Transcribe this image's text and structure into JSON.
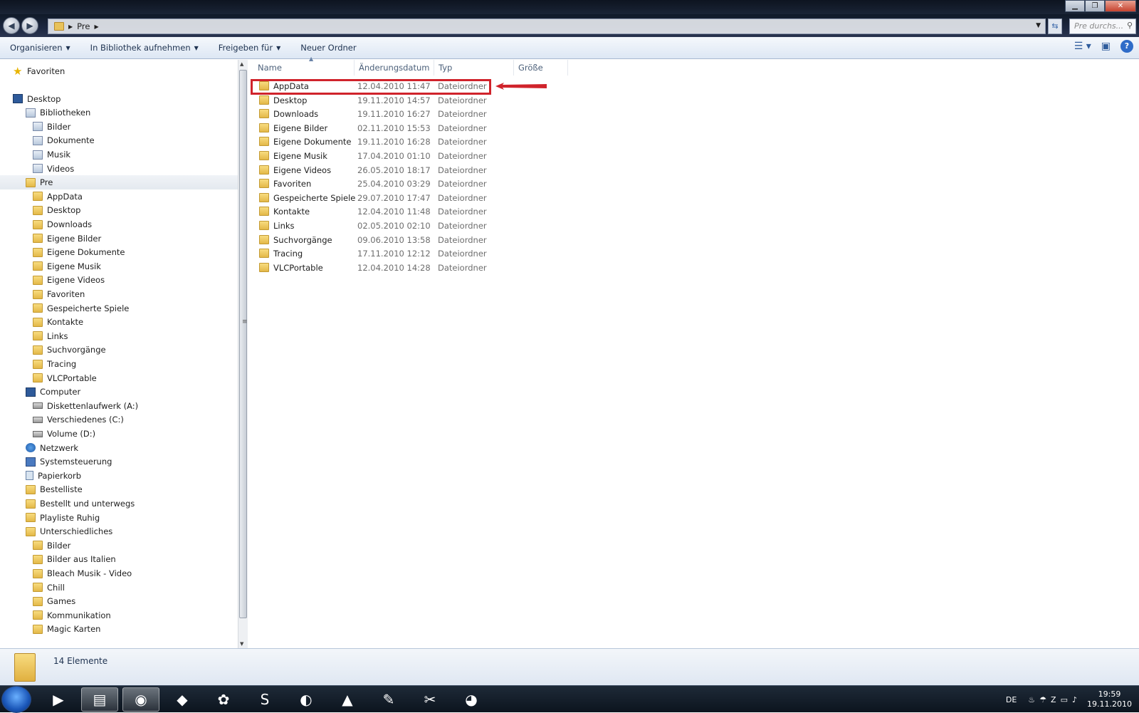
{
  "window": {
    "controls": {
      "minimize": "▁",
      "maximize": "❐",
      "close": "✕"
    }
  },
  "address": {
    "crumbs": [
      "Pre"
    ],
    "search_placeholder": "Pre durchs..."
  },
  "toolbar": {
    "organize": "Organisieren",
    "library": "In Bibliothek aufnehmen",
    "share": "Freigeben für",
    "new_folder": "Neuer Ordner"
  },
  "nav": [
    {
      "label": "Favoriten",
      "icon": "star-icon",
      "indent": 0
    },
    {
      "label": "Desktop",
      "icon": "monitor-icon",
      "indent": 0
    },
    {
      "label": "Bibliotheken",
      "icon": "library-icon",
      "indent": 1
    },
    {
      "label": "Bilder",
      "icon": "pictures-library-icon",
      "indent": 2
    },
    {
      "label": "Dokumente",
      "icon": "documents-library-icon",
      "indent": 2
    },
    {
      "label": "Musik",
      "icon": "music-library-icon",
      "indent": 2
    },
    {
      "label": "Videos",
      "icon": "videos-library-icon",
      "indent": 2
    },
    {
      "label": "Pre",
      "icon": "user-folder-icon",
      "indent": 1,
      "selected": true
    },
    {
      "label": "AppData",
      "icon": "folder-icon",
      "indent": 2
    },
    {
      "label": "Desktop",
      "icon": "folder-icon",
      "indent": 2
    },
    {
      "label": "Downloads",
      "icon": "folder-icon",
      "indent": 2
    },
    {
      "label": "Eigene Bilder",
      "icon": "folder-icon",
      "indent": 2
    },
    {
      "label": "Eigene Dokumente",
      "icon": "folder-icon",
      "indent": 2
    },
    {
      "label": "Eigene Musik",
      "icon": "folder-icon",
      "indent": 2
    },
    {
      "label": "Eigene Videos",
      "icon": "folder-icon",
      "indent": 2
    },
    {
      "label": "Favoriten",
      "icon": "folder-icon",
      "indent": 2
    },
    {
      "label": "Gespeicherte Spiele",
      "icon": "folder-icon",
      "indent": 2
    },
    {
      "label": "Kontakte",
      "icon": "folder-icon",
      "indent": 2
    },
    {
      "label": "Links",
      "icon": "folder-icon",
      "indent": 2
    },
    {
      "label": "Suchvorgänge",
      "icon": "folder-icon",
      "indent": 2
    },
    {
      "label": "Tracing",
      "icon": "folder-icon",
      "indent": 2
    },
    {
      "label": "VLCPortable",
      "icon": "folder-icon",
      "indent": 2
    },
    {
      "label": "Computer",
      "icon": "computer-icon",
      "indent": 1
    },
    {
      "label": "Diskettenlaufwerk (A:)",
      "icon": "floppy-drive-icon",
      "indent": 2
    },
    {
      "label": "Verschiedenes (C:)",
      "icon": "hard-drive-icon",
      "indent": 2
    },
    {
      "label": "Volume (D:)",
      "icon": "hard-drive-icon",
      "indent": 2
    },
    {
      "label": "Netzwerk",
      "icon": "network-icon",
      "indent": 1
    },
    {
      "label": "Systemsteuerung",
      "icon": "control-panel-icon",
      "indent": 1
    },
    {
      "label": "Papierkorb",
      "icon": "recycle-bin-icon",
      "indent": 1
    },
    {
      "label": "Bestelliste",
      "icon": "folder-icon",
      "indent": 1
    },
    {
      "label": "Bestellt und unterwegs",
      "icon": "folder-icon",
      "indent": 1
    },
    {
      "label": "Playliste Ruhig",
      "icon": "folder-icon",
      "indent": 1
    },
    {
      "label": "Unterschiedliches",
      "icon": "folder-icon",
      "indent": 1
    },
    {
      "label": "Bilder",
      "icon": "folder-icon",
      "indent": 2
    },
    {
      "label": "Bilder aus Italien",
      "icon": "folder-icon",
      "indent": 2
    },
    {
      "label": "Bleach  Musik - Video",
      "icon": "folder-icon",
      "indent": 2
    },
    {
      "label": "Chill",
      "icon": "folder-icon",
      "indent": 2
    },
    {
      "label": "Games",
      "icon": "folder-icon",
      "indent": 2
    },
    {
      "label": "Kommunikation",
      "icon": "folder-icon",
      "indent": 2
    },
    {
      "label": "Magic Karten",
      "icon": "folder-icon",
      "indent": 2
    }
  ],
  "columns": [
    "Name",
    "Änderungsdatum",
    "Typ",
    "Größe"
  ],
  "files": [
    {
      "name": "AppData",
      "date": "12.04.2010 11:47",
      "type": "Dateiordner",
      "highlighted": true
    },
    {
      "name": "Desktop",
      "date": "19.11.2010 14:57",
      "type": "Dateiordner"
    },
    {
      "name": "Downloads",
      "date": "19.11.2010 16:27",
      "type": "Dateiordner"
    },
    {
      "name": "Eigene Bilder",
      "date": "02.11.2010 15:53",
      "type": "Dateiordner"
    },
    {
      "name": "Eigene Dokumente",
      "date": "19.11.2010 16:28",
      "type": "Dateiordner"
    },
    {
      "name": "Eigene Musik",
      "date": "17.04.2010 01:10",
      "type": "Dateiordner"
    },
    {
      "name": "Eigene Videos",
      "date": "26.05.2010 18:17",
      "type": "Dateiordner"
    },
    {
      "name": "Favoriten",
      "date": "25.04.2010 03:29",
      "type": "Dateiordner"
    },
    {
      "name": "Gespeicherte Spiele",
      "date": "29.07.2010 17:47",
      "type": "Dateiordner"
    },
    {
      "name": "Kontakte",
      "date": "12.04.2010 11:48",
      "type": "Dateiordner"
    },
    {
      "name": "Links",
      "date": "02.05.2010 02:10",
      "type": "Dateiordner"
    },
    {
      "name": "Suchvorgänge",
      "date": "09.06.2010 13:58",
      "type": "Dateiordner"
    },
    {
      "name": "Tracing",
      "date": "17.11.2010 12:12",
      "type": "Dateiordner"
    },
    {
      "name": "VLCPortable",
      "date": "12.04.2010 14:28",
      "type": "Dateiordner"
    }
  ],
  "status": {
    "count": "14 Elemente"
  },
  "taskbar": {
    "apps": [
      {
        "name": "media-player-icon",
        "glyph": "▶"
      },
      {
        "name": "explorer-icon",
        "glyph": "▤",
        "active": true
      },
      {
        "name": "firefox-icon",
        "glyph": "◉",
        "active": true
      },
      {
        "name": "folders-icon",
        "glyph": "◆"
      },
      {
        "name": "icq-icon",
        "glyph": "✿"
      },
      {
        "name": "skype-icon",
        "glyph": "S"
      },
      {
        "name": "teamspeak-icon",
        "glyph": "◐"
      },
      {
        "name": "vlc-icon",
        "glyph": "▲"
      },
      {
        "name": "paint-icon",
        "glyph": "✎"
      },
      {
        "name": "snipping-tool-icon",
        "glyph": "✂"
      },
      {
        "name": "emule-icon",
        "glyph": "◕"
      }
    ],
    "lang": "DE",
    "time": "19:59",
    "date": "19.11.2010"
  },
  "colors": {
    "highlight": "#d0232b",
    "accent": "#2f6cc8"
  }
}
